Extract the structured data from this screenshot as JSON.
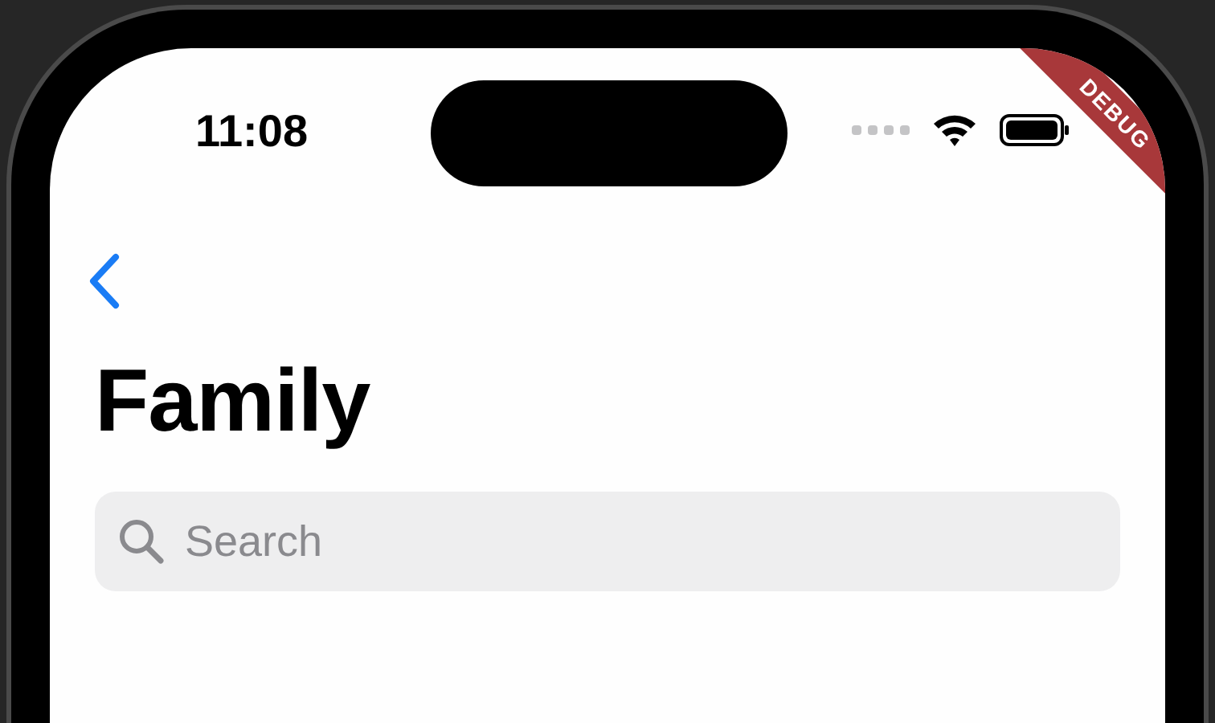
{
  "status_bar": {
    "time": "11:08"
  },
  "title": "Family",
  "search": {
    "placeholder": "Search"
  },
  "debug_banner": {
    "label": "DEBUG"
  }
}
